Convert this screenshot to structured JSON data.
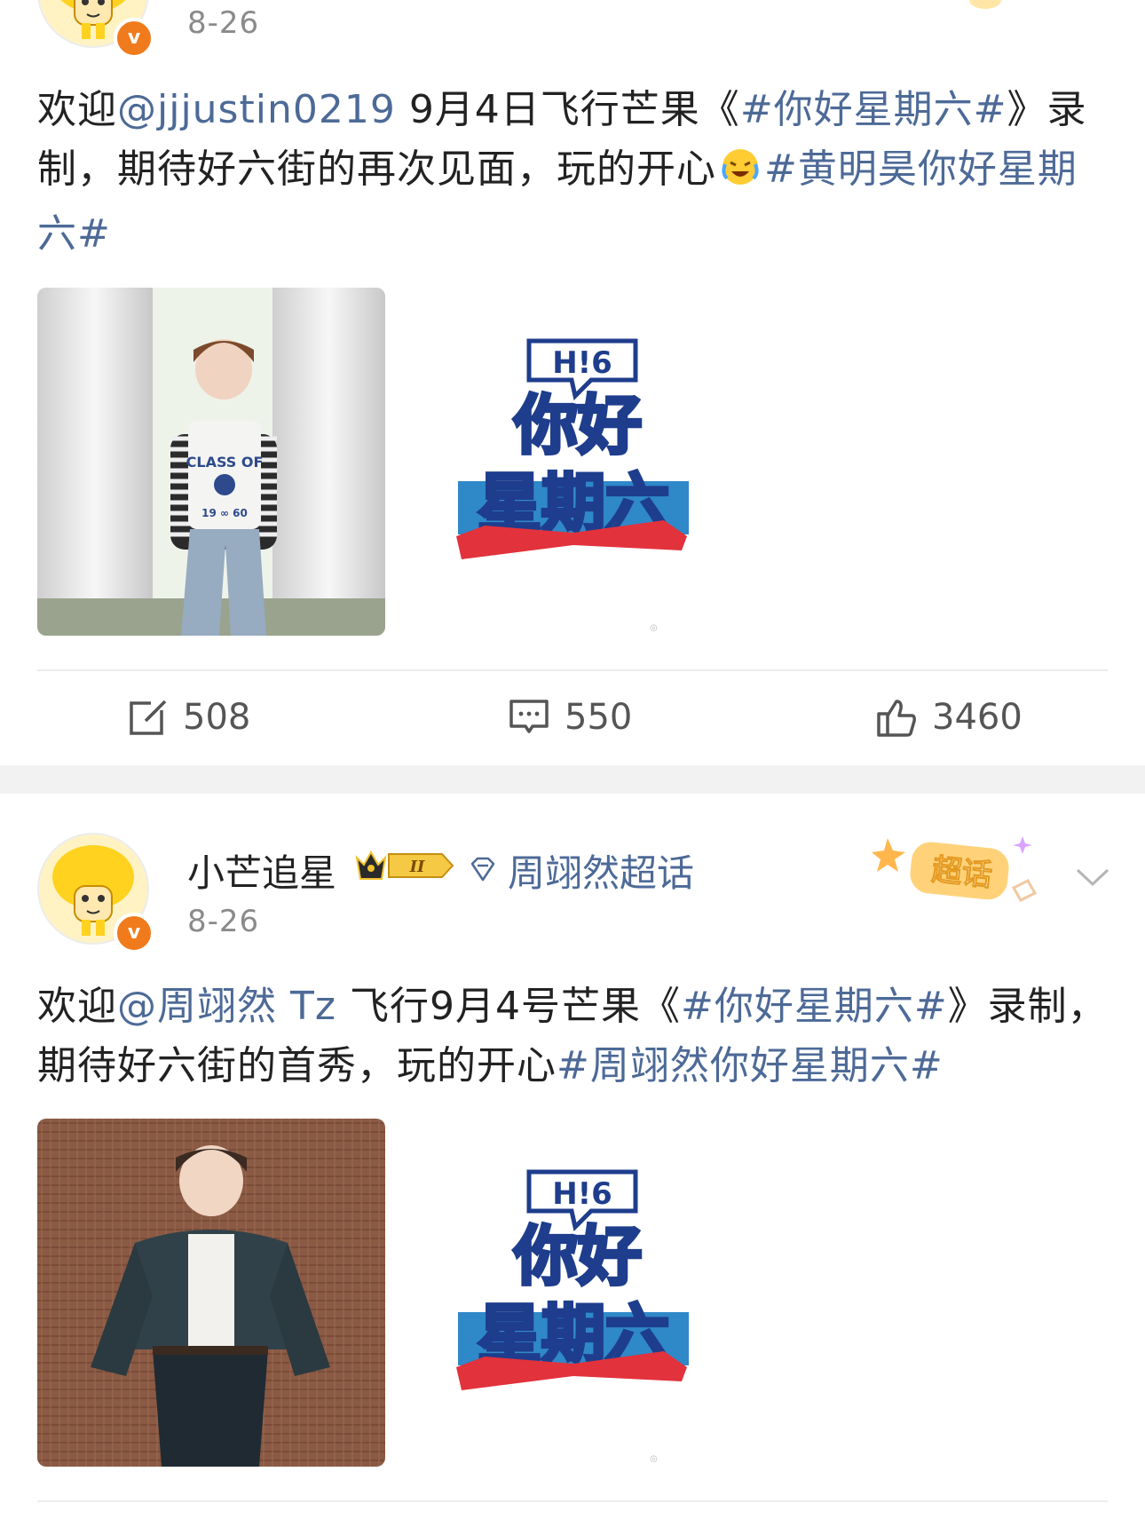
{
  "colors": {
    "link": "#4d6a97",
    "text": "#222222",
    "muted": "#8a8a8a",
    "verify": "#f07b1d",
    "separator": "#f2f2f2"
  },
  "post1": {
    "date": "8-26",
    "text": {
      "part1": "欢迎",
      "mention": "@jjjustin0219",
      "part2": " 9月4日飞行芒果《",
      "hashtag1": "#你好星期六#",
      "part3": "》录制，期待好六街的再次见面，玩的开心",
      "emoji": "laughing-crying-emoji",
      "hashtag2": "#黄明昊你好星期六#"
    },
    "photo_text": {
      "line1": "CLASS OF",
      "line2": "19 ∞ 60"
    },
    "logo": {
      "badge": "H!6",
      "line1": "你好",
      "line2": "星期六"
    },
    "actions": {
      "repost_count": "508",
      "comment_count": "550",
      "like_count": "3460"
    }
  },
  "post2": {
    "username": "小芒追星",
    "level_badge": "II",
    "topic": "周翊然超话",
    "supertopic_sticker": "超话",
    "date": "8-26",
    "text": {
      "part1": "欢迎",
      "mention": "@周翊然 Tz",
      "part2": " 飞行9月4号芒果《",
      "hashtag1": "#你好星期六#",
      "part3": "》录制，期待好六街的首秀，玩的开心",
      "hashtag2": "#周翊然你好星期六#"
    },
    "logo": {
      "badge": "H!6",
      "line1": "你好",
      "line2": "星期六"
    }
  }
}
